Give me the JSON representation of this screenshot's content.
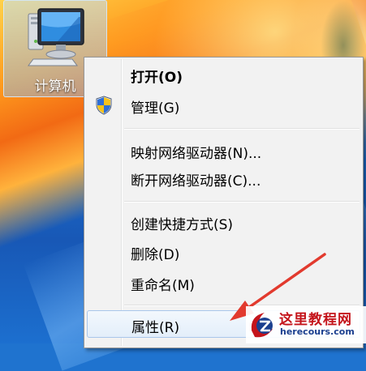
{
  "desktop": {
    "computer_icon": {
      "label": "计算机",
      "icon": "computer-icon"
    }
  },
  "context_menu": {
    "items": [
      {
        "label": "打开(O)",
        "bold": true,
        "icon": null
      },
      {
        "label": "管理(G)",
        "bold": false,
        "icon": "uac-shield-icon"
      },
      {
        "label": "映射网络驱动器(N)...",
        "bold": false,
        "icon": null
      },
      {
        "label": "断开网络驱动器(C)...",
        "bold": false,
        "icon": null
      },
      {
        "label": "创建快捷方式(S)",
        "bold": false,
        "icon": null
      },
      {
        "label": "删除(D)",
        "bold": false,
        "icon": null
      },
      {
        "label": "重命名(M)",
        "bold": false,
        "icon": null
      },
      {
        "label": "属性(R)",
        "bold": false,
        "icon": null,
        "highlighted": true
      }
    ]
  },
  "annotation": {
    "arrow_color": "#e23a2e",
    "points_to": "属性(R)"
  },
  "watermark": {
    "title": "这里教程网",
    "url": "herecours.com",
    "brand_colors": {
      "red": "#c4141b",
      "blue": "#1b3f8f"
    }
  }
}
